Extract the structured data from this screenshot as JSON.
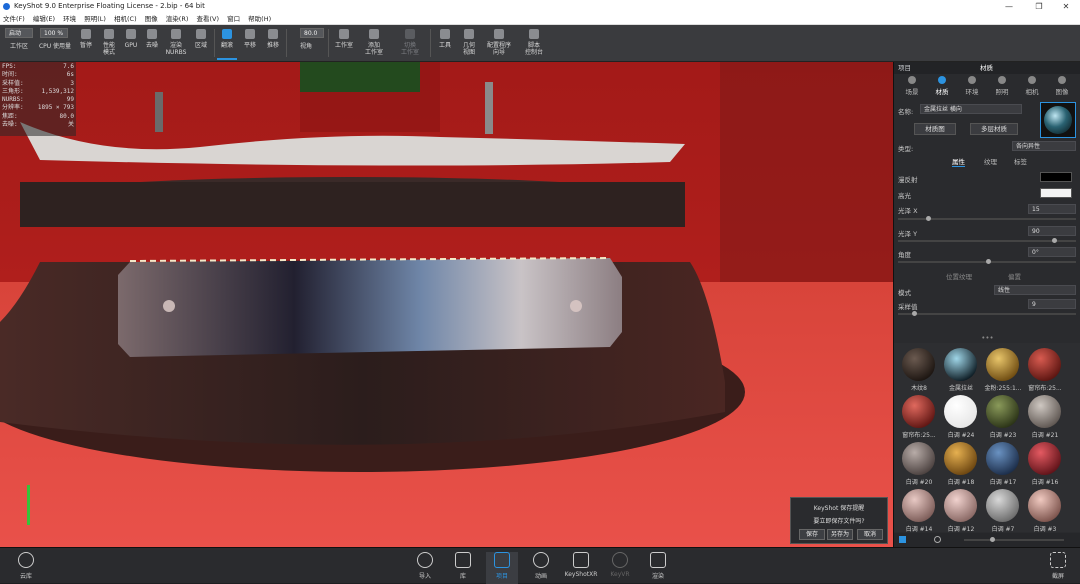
{
  "window": {
    "title": "KeyShot 9.0 Enterprise Floating License  - 2.bip  - 64 bit",
    "minimize": "—",
    "maximize": "❐",
    "close": "✕"
  },
  "menu": [
    "文件(F)",
    "编辑(E)",
    "环境",
    "照明(L)",
    "相机(C)",
    "图像",
    "渲染(R)",
    "查看(V)",
    "窗口",
    "帮助(H)"
  ],
  "toolbar": {
    "mode_select": "启动",
    "zoom_select": "100 %",
    "focal_value": "80.0",
    "items": [
      "工作区",
      "CPU 使用量",
      "暂停",
      "性能\n模式",
      "GPU",
      "去噪",
      "渲染\nNURBS",
      "区域",
      "翻滚",
      "平移",
      "推移",
      "视角",
      "工作室",
      "添加\n工作室",
      "切换\n工作室",
      "工具",
      "几何\n视图",
      "配置程序\n向导",
      "脚本\n控制台"
    ]
  },
  "stats": [
    {
      "k": "FPS:",
      "v": "7.6"
    },
    {
      "k": "时间:",
      "v": "6s"
    },
    {
      "k": "采样值:",
      "v": "3"
    },
    {
      "k": "三角形:",
      "v": "1,539,312"
    },
    {
      "k": "NURBS:",
      "v": "99"
    },
    {
      "k": "分辨率:",
      "v": "1895 × 793"
    },
    {
      "k": "焦距:",
      "v": "80.0"
    },
    {
      "k": "去噪:",
      "v": "关"
    }
  ],
  "dialog": {
    "title": "KeyShot 保存提醒",
    "message": "要立即保存文件吗?",
    "save": "保存",
    "save_as": "另存为",
    "cancel": "取消"
  },
  "panel": {
    "header_left": "项目",
    "header_center": "材质",
    "tabs": [
      "场景",
      "材质",
      "环境",
      "照明",
      "相机",
      "图像"
    ],
    "active_tab": "材质",
    "name_label": "名称:",
    "name_value": "金属拉丝 横向",
    "btn_material_graph": "材质图",
    "btn_multi_material": "多层材质",
    "type_label": "类型:",
    "type_value": "各向异性",
    "subtabs": [
      "属性",
      "纹理",
      "标签"
    ],
    "props": {
      "diffuse": "漫反射",
      "specular": "高光",
      "rough_x": "光泽 X",
      "rough_x_val": "15",
      "rough_y": "光泽 Y",
      "rough_y_val": "90",
      "angle": "角度",
      "angle_val": "0°",
      "uv_label": "位置纹理",
      "plane_label": "偏置",
      "mode": "模式",
      "mode_val": "线性",
      "samples": "采样值",
      "samples_val": "9"
    },
    "ellipsis": "•••",
    "library": [
      {
        "name": "木纹8",
        "c1": "#6b5a50",
        "c2": "#1b1410"
      },
      {
        "name": "金属拉丝",
        "c1": "#9fd6e8",
        "c2": "#0c1a22"
      },
      {
        "name": "金粉:255:1...",
        "c1": "#e8c56a",
        "c2": "#6d4a10"
      },
      {
        "name": "窗帘布:25...",
        "c1": "#d85b50",
        "c2": "#5a1410"
      },
      {
        "name": "窗帘布:25...",
        "c1": "#e0695e",
        "c2": "#5e1512"
      },
      {
        "name": "白调 #24",
        "c1": "#ffffff",
        "c2": "#e6e6e6"
      },
      {
        "name": "白调 #23",
        "c1": "#8a9a5a",
        "c2": "#2a3216"
      },
      {
        "name": "白调 #21",
        "c1": "#cfc8c2",
        "c2": "#5d5550"
      },
      {
        "name": "白调 #20",
        "c1": "#b8aca8",
        "c2": "#4a403e"
      },
      {
        "name": "白调 #18",
        "c1": "#e6b050",
        "c2": "#6a4410"
      },
      {
        "name": "白调 #17",
        "c1": "#6a92c2",
        "c2": "#1b2c48"
      },
      {
        "name": "白调 #16",
        "c1": "#e45a62",
        "c2": "#5e1218"
      },
      {
        "name": "白调 #14",
        "c1": "#e8c9c4",
        "c2": "#7a5a56"
      },
      {
        "name": "白调 #12",
        "c1": "#f1d2ce",
        "c2": "#876662"
      },
      {
        "name": "白调 #7",
        "c1": "#d8d8d8",
        "c2": "#6a6a6a"
      },
      {
        "name": "白调 #3",
        "c1": "#f0c9c0",
        "c2": "#7a514a"
      }
    ]
  },
  "statusbar": {
    "cloud": "云库",
    "import": "导入",
    "library": "库",
    "project": "项目",
    "animation": "动画",
    "keyshotxr": "KeyShotXR",
    "keyvr": "KeyVR",
    "render": "渲染",
    "screenshot": "截屏"
  },
  "colors": {
    "accent": "#2c93e0",
    "scene_red": "#c2221f"
  }
}
